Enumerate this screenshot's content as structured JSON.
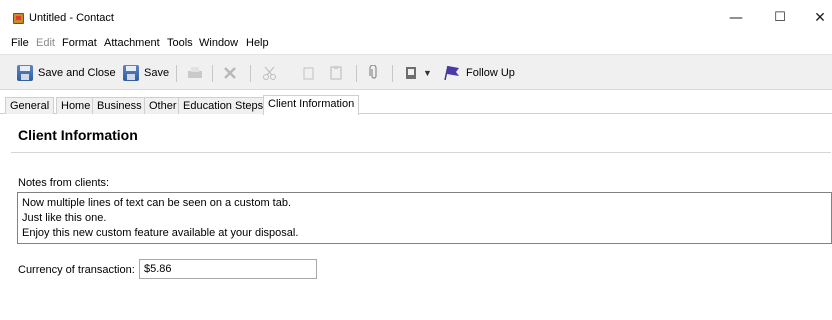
{
  "window": {
    "title": "Untitled - Contact",
    "minimize": "—",
    "maximize": "☐",
    "close": "✕"
  },
  "menu": [
    "File",
    "Edit",
    "Format",
    "Attachment",
    "Tools",
    "Window",
    "Help"
  ],
  "toolbar": {
    "save_and_close": "Save and Close",
    "save": "Save",
    "follow_up": "Follow Up"
  },
  "tabs": [
    "General",
    "Home",
    "Business",
    "Other",
    "Education Steps",
    "Client Information"
  ],
  "active_tab": "Client Information",
  "section": {
    "title": "Client Information"
  },
  "notes": {
    "label": "Notes from clients:",
    "lines": [
      "Now multiple lines of text can be seen on a custom tab.",
      "Just like this one.",
      "Enjoy this new custom feature available at your disposal."
    ]
  },
  "currency": {
    "label": "Currency of transaction:",
    "value": "$5.86"
  }
}
